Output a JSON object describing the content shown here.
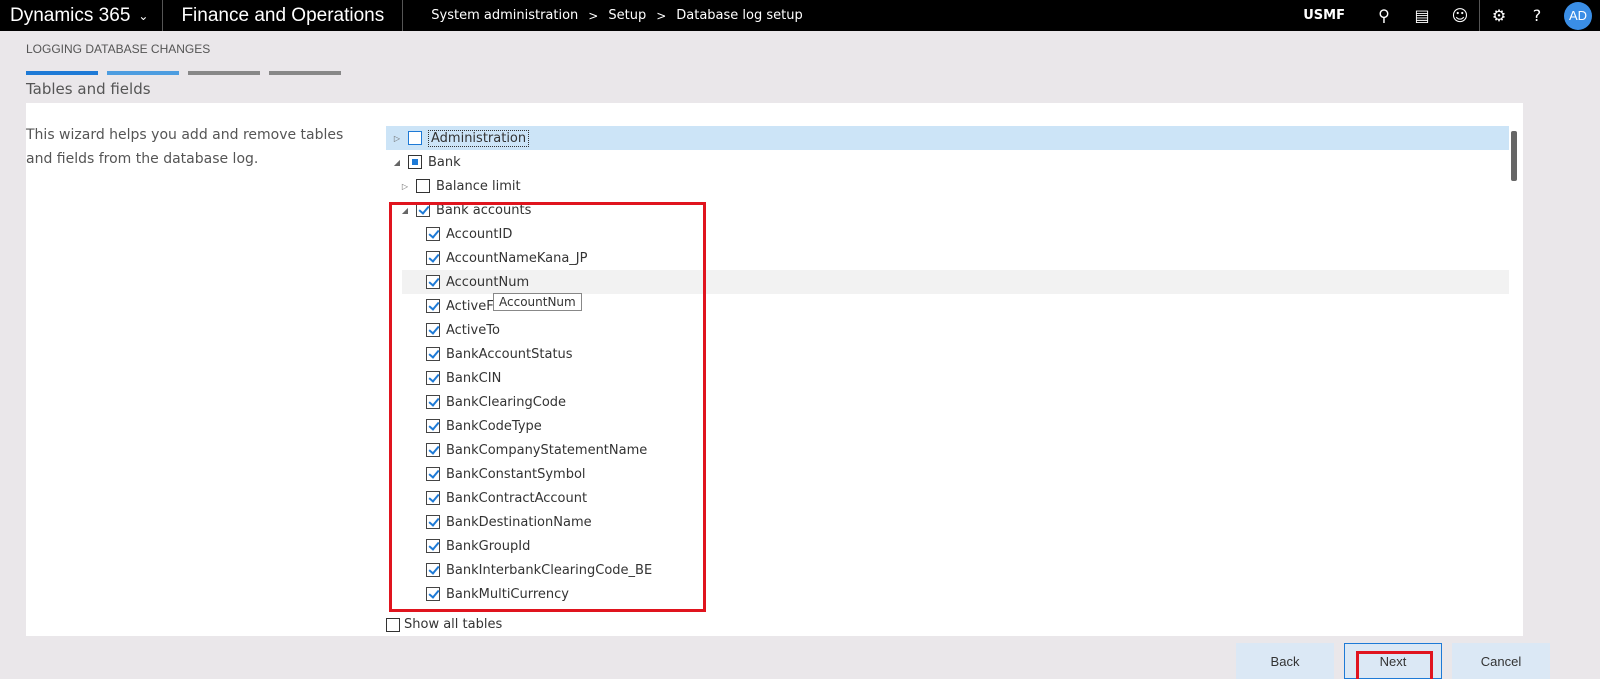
{
  "topbar": {
    "app_name": "Dynamics 365",
    "module": "Finance and Operations",
    "breadcrumb": [
      "System administration",
      "Setup",
      "Database log setup"
    ],
    "company": "USMF",
    "avatar_initials": "AD",
    "icons": [
      "search-icon",
      "message-icon",
      "smiley-icon",
      "gear-icon",
      "help-icon"
    ]
  },
  "wizard": {
    "caption": "LOGGING DATABASE CHANGES",
    "subtitle": "Tables and fields",
    "help_text": "This wizard helps you add and remove tables and fields from the database log."
  },
  "tree": {
    "rows": [
      {
        "label": "Administration",
        "expander": "collapsed",
        "check": "empty-blue"
      },
      {
        "label": "Bank",
        "expander": "expanded",
        "check": "partial"
      },
      {
        "label": "Balance limit",
        "expander": "collapsed",
        "check": "empty"
      },
      {
        "label": "Bank accounts",
        "expander": "expanded",
        "check": "checked"
      },
      {
        "label": "AccountID",
        "check": "checked"
      },
      {
        "label": "AccountNameKana_JP",
        "check": "checked"
      },
      {
        "label": "AccountNum",
        "check": "checked"
      },
      {
        "label": "ActiveFrom",
        "check": "checked"
      },
      {
        "label": "ActiveTo",
        "check": "checked"
      },
      {
        "label": "BankAccountStatus",
        "check": "checked"
      },
      {
        "label": "BankCIN",
        "check": "checked"
      },
      {
        "label": "BankClearingCode",
        "check": "checked"
      },
      {
        "label": "BankCodeType",
        "check": "checked"
      },
      {
        "label": "BankCompanyStatementName",
        "check": "checked"
      },
      {
        "label": "BankConstantSymbol",
        "check": "checked"
      },
      {
        "label": "BankContractAccount",
        "check": "checked"
      },
      {
        "label": "BankDestinationName",
        "check": "checked"
      },
      {
        "label": "BankGroupId",
        "check": "checked"
      },
      {
        "label": "BankInterbankClearingCode_BE",
        "check": "checked"
      },
      {
        "label": "BankMultiCurrency",
        "check": "checked"
      }
    ],
    "tooltip": "AccountNum",
    "show_all_label": "Show all tables"
  },
  "footer": {
    "back_label": "Back",
    "next_label": "Next",
    "cancel_label": "Cancel"
  },
  "colors": {
    "accent": "#1e7ad6",
    "highlight": "#e0141e",
    "selected_row": "#cce4f7"
  }
}
